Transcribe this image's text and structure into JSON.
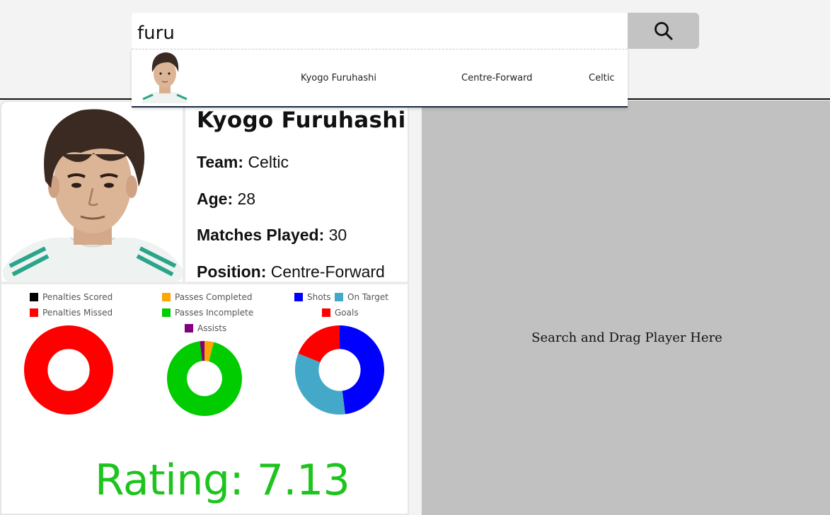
{
  "search": {
    "value": "furu",
    "button_icon": "search-icon"
  },
  "suggestion": {
    "name": "Kyogo Furuhashi",
    "position": "Centre-Forward",
    "team": "Celtic"
  },
  "player": {
    "name": "Kyogo Furuhashi",
    "team_label": "Team:",
    "team": "Celtic",
    "age_label": "Age:",
    "age": "28",
    "matches_label": "Matches Played:",
    "matches": "30",
    "position_label": "Position:",
    "position": "Centre-Forward",
    "rating_text": "Rating: 7.13"
  },
  "legends": {
    "penalties": [
      "Penalties Scored",
      "Penalties Missed"
    ],
    "passes": [
      "Passes Completed",
      "Passes Incomplete",
      "Assists"
    ],
    "shots": [
      "Shots",
      "On Target",
      "Goals"
    ]
  },
  "colors": {
    "penalties_scored": "#000000",
    "penalties_missed": "#ff0000",
    "passes_completed": "#ffa500",
    "passes_incomplete": "#00cc00",
    "assists": "#800080",
    "shots": "#0000ff",
    "on_target": "#44a8c8",
    "goals": "#ff0000",
    "rating": "#1ec41e"
  },
  "chart_data": [
    {
      "type": "pie",
      "categories": [
        "Penalties Scored",
        "Penalties Missed"
      ],
      "values": [
        0,
        100
      ]
    },
    {
      "type": "pie",
      "categories": [
        "Passes Completed",
        "Passes Incomplete",
        "Assists"
      ],
      "values": [
        4,
        94,
        2
      ]
    },
    {
      "type": "pie",
      "categories": [
        "Shots",
        "On Target",
        "Goals"
      ],
      "values": [
        48,
        33,
        19
      ]
    }
  ],
  "drop_zone": {
    "text": "Search and Drag Player Here"
  }
}
